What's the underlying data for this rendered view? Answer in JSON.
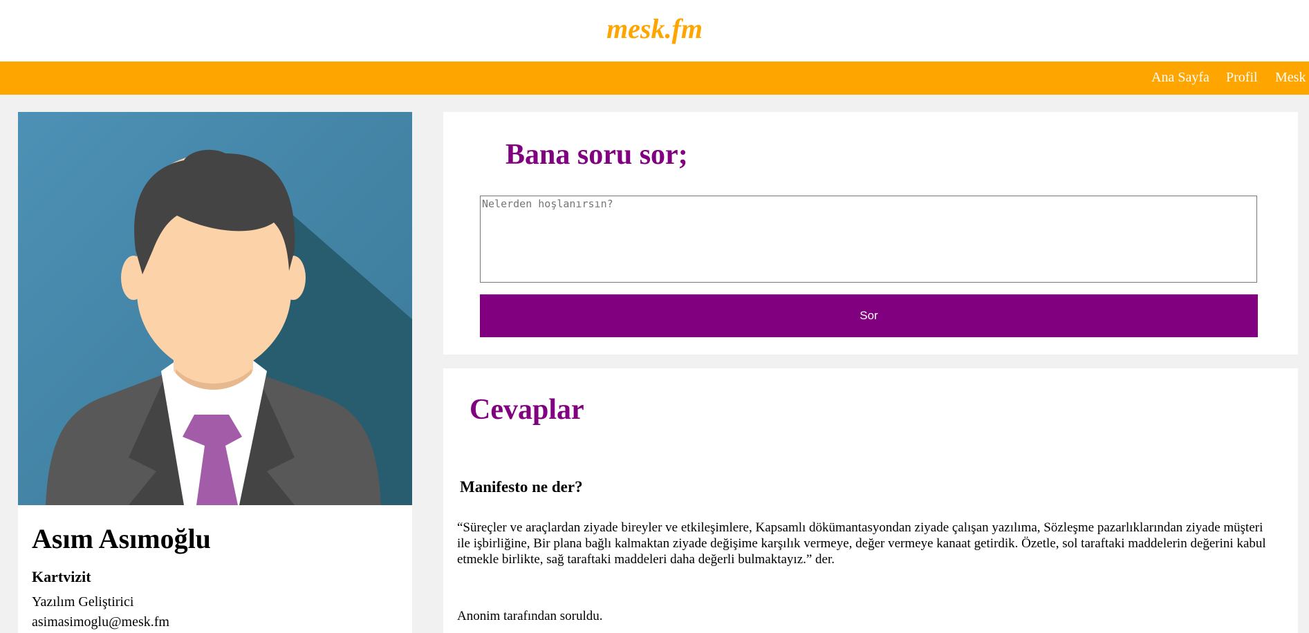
{
  "header": {
    "logo": "mesk.fm"
  },
  "nav": {
    "items": [
      {
        "label": "Ana Sayfa"
      },
      {
        "label": "Profil"
      },
      {
        "label": "Mesk"
      }
    ]
  },
  "profile": {
    "name": "Asım Asımoğlu",
    "card_label": "Kartvizit",
    "job_title": "Yazılım Geliştirici",
    "email": "asimasimoglu@mesk.fm",
    "colors": {
      "background": "#4a8db0",
      "shadow": "#285d70",
      "hair": "#444444",
      "skin": "#fcd3a9",
      "suit": "#585858",
      "shirt": "#ffffff",
      "tie": "#a35da8"
    }
  },
  "ask": {
    "title": "Bana soru sor;",
    "placeholder": "Nelerden hoşlanırsın?",
    "button_label": "Sor"
  },
  "answers": {
    "title": "Cevaplar",
    "items": [
      {
        "question": "Manifesto ne der?",
        "answer": "“Süreçler ve araçlardan ziyade bireyler ve etkileşimlere, Kapsamlı dökümantasyondan ziyade çalışan yazılıma, Sözleşme pazarlıklarından ziyade müşteri ile işbirliğine, Bir plana bağlı kalmaktan ziyade değişime karşılık vermeye, değer vermeye kanaat getirdik. Özetle, sol taraftaki maddelerin değerini kabul etmekle birlikte, sağ taraftaki maddeleri daha değerli bulmaktayız.” der.",
        "asked_by": "Anonim tarafından soruldu."
      }
    ]
  },
  "colors": {
    "accent_orange": "#ffa500",
    "accent_purple": "#800080",
    "page_background": "#f1f1f1"
  }
}
